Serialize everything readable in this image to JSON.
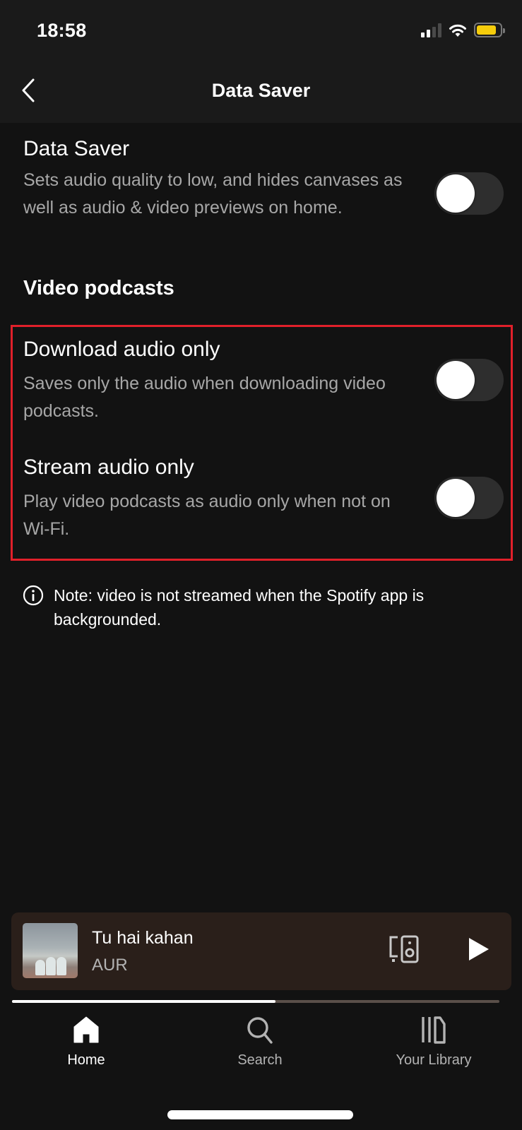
{
  "status_bar": {
    "time": "18:58",
    "signal_bars_active": 2,
    "signal_bars_total": 4,
    "wifi_icon": "wifi-icon",
    "battery_level": 0.85,
    "battery_color": "#f5cc0b"
  },
  "header": {
    "back_icon": "chevron-left-icon",
    "title": "Data Saver"
  },
  "settings": {
    "data_saver": {
      "title": "Data Saver",
      "description": "Sets audio quality to low, and hides canvases as well as audio & video previews on home.",
      "enabled": false
    },
    "section_heading": "Video podcasts",
    "download_audio_only": {
      "title": "Download audio only",
      "description": "Saves only the audio when downloading video podcasts.",
      "enabled": false
    },
    "stream_audio_only": {
      "title": "Stream audio only",
      "description": "Play video podcasts as audio only when not on Wi-Fi.",
      "enabled": false
    },
    "highlight_color": "#e0202a"
  },
  "note": {
    "icon": "info-icon",
    "text": "Note: video is not streamed when the Spotify app is backgrounded."
  },
  "now_playing": {
    "title": "Tu hai kahan",
    "artist": "AUR",
    "progress_percent": 54,
    "device_icon": "devices-speaker-icon",
    "play_icon": "play-icon",
    "background_color": "#2a1f1a"
  },
  "tabs": [
    {
      "label": "Home",
      "icon": "home-icon",
      "active": true
    },
    {
      "label": "Search",
      "icon": "search-icon",
      "active": false
    },
    {
      "label": "Your Library",
      "icon": "library-icon",
      "active": false
    }
  ]
}
